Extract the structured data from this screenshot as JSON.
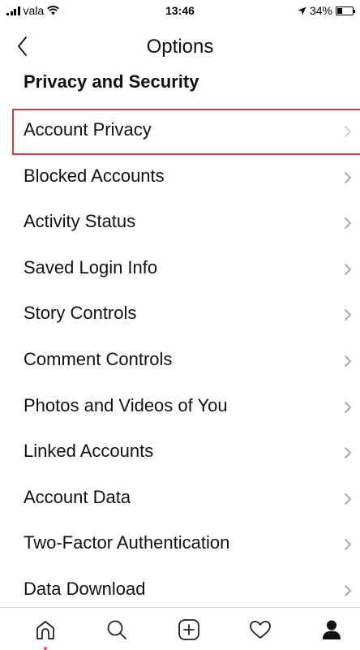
{
  "status_bar": {
    "carrier": "vala",
    "time": "13:46",
    "battery_text": "34%",
    "battery_level": 0.34
  },
  "nav": {
    "title": "Options"
  },
  "section": {
    "title": "Privacy and Security"
  },
  "options": [
    {
      "label": "Account Privacy",
      "highlighted": true
    },
    {
      "label": "Blocked Accounts"
    },
    {
      "label": "Activity Status"
    },
    {
      "label": "Saved Login Info"
    },
    {
      "label": "Story Controls"
    },
    {
      "label": "Comment Controls"
    },
    {
      "label": "Photos and Videos of You"
    },
    {
      "label": "Linked Accounts"
    },
    {
      "label": "Account Data"
    },
    {
      "label": "Two-Factor Authentication"
    },
    {
      "label": "Data Download"
    }
  ],
  "tab_bar": {
    "tabs": [
      "home-icon",
      "search-icon",
      "new-post-icon",
      "activity-heart-icon",
      "profile-icon"
    ],
    "active_tab": "profile-icon"
  },
  "colors": {
    "highlight_border": "#e0323a",
    "chevron": "#9a9a9a",
    "notification_dot": "#ed4956"
  }
}
